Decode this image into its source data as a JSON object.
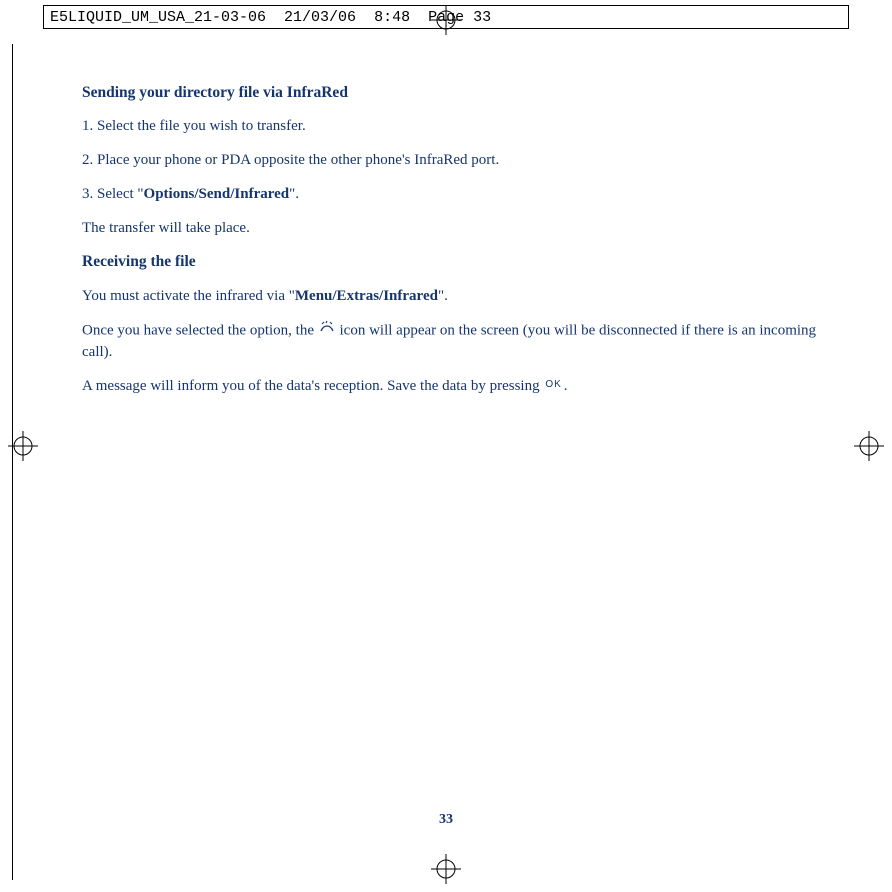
{
  "header": {
    "filename": "E5LIQUID_UM_USA_21-03-06",
    "date": "21/03/06",
    "time": "8:48",
    "page_label": "Page 33"
  },
  "content": {
    "heading1": "Sending your directory file via InfraRed",
    "step1_num": "1.",
    "step1_text": "Select the file you wish to transfer.",
    "step2_num": "2.",
    "step2_text": "Place your phone or PDA opposite the other phone's InfraRed port.",
    "step3_num": "3.",
    "step3_prefix": "Select \"",
    "step3_bold": "Options/Send/Infrared",
    "step3_suffix": "\".",
    "after_steps": "The transfer will take place.",
    "heading2": "Receiving the file",
    "recv_prefix": "You must activate the infrared via \"",
    "recv_bold": "Menu/Extras/Infrared",
    "recv_suffix": "\".",
    "icon_para_before": "Once you have selected the option, the ",
    "icon_para_after": " icon will appear on the screen (you will be disconnected if there is an incoming call).",
    "save_para_before": "A message will inform you of the data's reception. Save the data by pressing ",
    "save_para_after": ".",
    "ok_label": "OK",
    "page_number": "33"
  }
}
